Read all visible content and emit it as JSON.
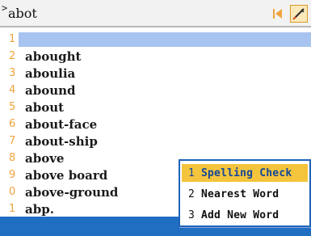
{
  "search": {
    "query": "abot",
    "caret": ">"
  },
  "results": [
    {
      "num": "1",
      "word": "",
      "selected": true
    },
    {
      "num": "2",
      "word": "abought"
    },
    {
      "num": "3",
      "word": "aboulia"
    },
    {
      "num": "4",
      "word": "abound"
    },
    {
      "num": "5",
      "word": "about"
    },
    {
      "num": "6",
      "word": "about-face"
    },
    {
      "num": "7",
      "word": "about-ship"
    },
    {
      "num": "8",
      "word": "above"
    },
    {
      "num": "9",
      "word": "above board"
    },
    {
      "num": "0",
      "word": "above-ground"
    },
    {
      "num": "1",
      "word": "abp."
    }
  ],
  "popup_menu": {
    "items": [
      {
        "num": "1",
        "label": "Spelling Check",
        "highlighted": true
      },
      {
        "num": "2",
        "label": "Nearest Word"
      },
      {
        "num": "3",
        "label": "Add New Word"
      }
    ]
  },
  "icons": {
    "back": "back-arrow-icon",
    "edit": "pencil-icon"
  },
  "colors": {
    "accent_orange": "#f0a33c",
    "selection_blue": "#a7c3ef",
    "status_blue": "#1f6ec2",
    "menu_highlight": "#f4c43c"
  }
}
